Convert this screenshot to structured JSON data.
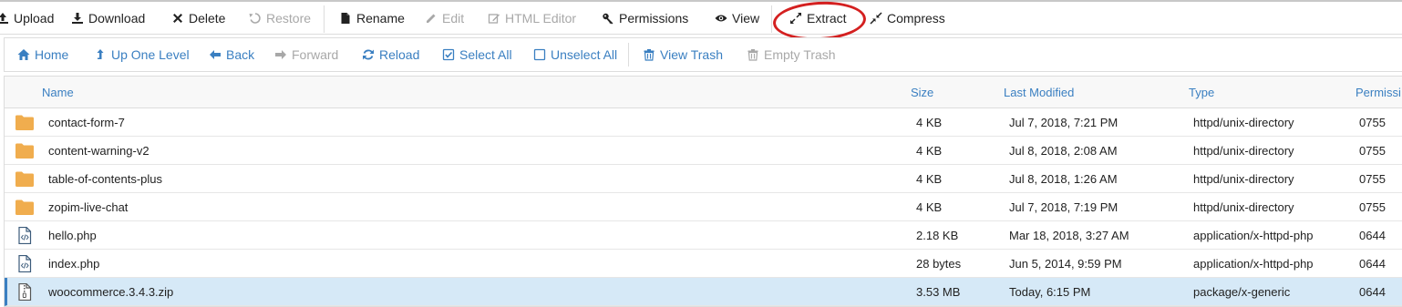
{
  "toolbar": {
    "upload": "Upload",
    "download": "Download",
    "delete": "Delete",
    "restore": "Restore",
    "rename": "Rename",
    "edit": "Edit",
    "html_editor": "HTML Editor",
    "permissions": "Permissions",
    "view": "View",
    "extract": "Extract",
    "compress": "Compress"
  },
  "nav": {
    "home": "Home",
    "up_one_level": "Up One Level",
    "back": "Back",
    "forward": "Forward",
    "reload": "Reload",
    "select_all": "Select All",
    "unselect_all": "Unselect All",
    "view_trash": "View Trash",
    "empty_trash": "Empty Trash"
  },
  "columns": {
    "name": "Name",
    "size": "Size",
    "last_modified": "Last Modified",
    "type": "Type",
    "permissions": "Permissi"
  },
  "files": [
    {
      "name": "contact-form-7",
      "size": "4 KB",
      "modified": "Jul 7, 2018, 7:21 PM",
      "type": "httpd/unix-directory",
      "perms": "0755",
      "icon": "folder-icon"
    },
    {
      "name": "content-warning-v2",
      "size": "4 KB",
      "modified": "Jul 8, 2018, 2:08 AM",
      "type": "httpd/unix-directory",
      "perms": "0755",
      "icon": "folder-icon"
    },
    {
      "name": "table-of-contents-plus",
      "size": "4 KB",
      "modified": "Jul 8, 2018, 1:26 AM",
      "type": "httpd/unix-directory",
      "perms": "0755",
      "icon": "folder-icon"
    },
    {
      "name": "zopim-live-chat",
      "size": "4 KB",
      "modified": "Jul 7, 2018, 7:19 PM",
      "type": "httpd/unix-directory",
      "perms": "0755",
      "icon": "folder-icon"
    },
    {
      "name": "hello.php",
      "size": "2.18 KB",
      "modified": "Mar 18, 2018, 3:27 AM",
      "type": "application/x-httpd-php",
      "perms": "0644",
      "icon": "code-file-icon"
    },
    {
      "name": "index.php",
      "size": "28 bytes",
      "modified": "Jun 5, 2014, 9:59 PM",
      "type": "application/x-httpd-php",
      "perms": "0644",
      "icon": "code-file-icon"
    },
    {
      "name": "woocommerce.3.4.3.zip",
      "size": "3.53 MB",
      "modified": "Today, 6:15 PM",
      "type": "package/x-generic",
      "perms": "0644",
      "icon": "archive-file-icon"
    }
  ],
  "colors": {
    "link": "#3a7fc1",
    "folder": "#f0ad4e",
    "selected_row": "#d6e9f7",
    "highlight": "#d42020"
  }
}
